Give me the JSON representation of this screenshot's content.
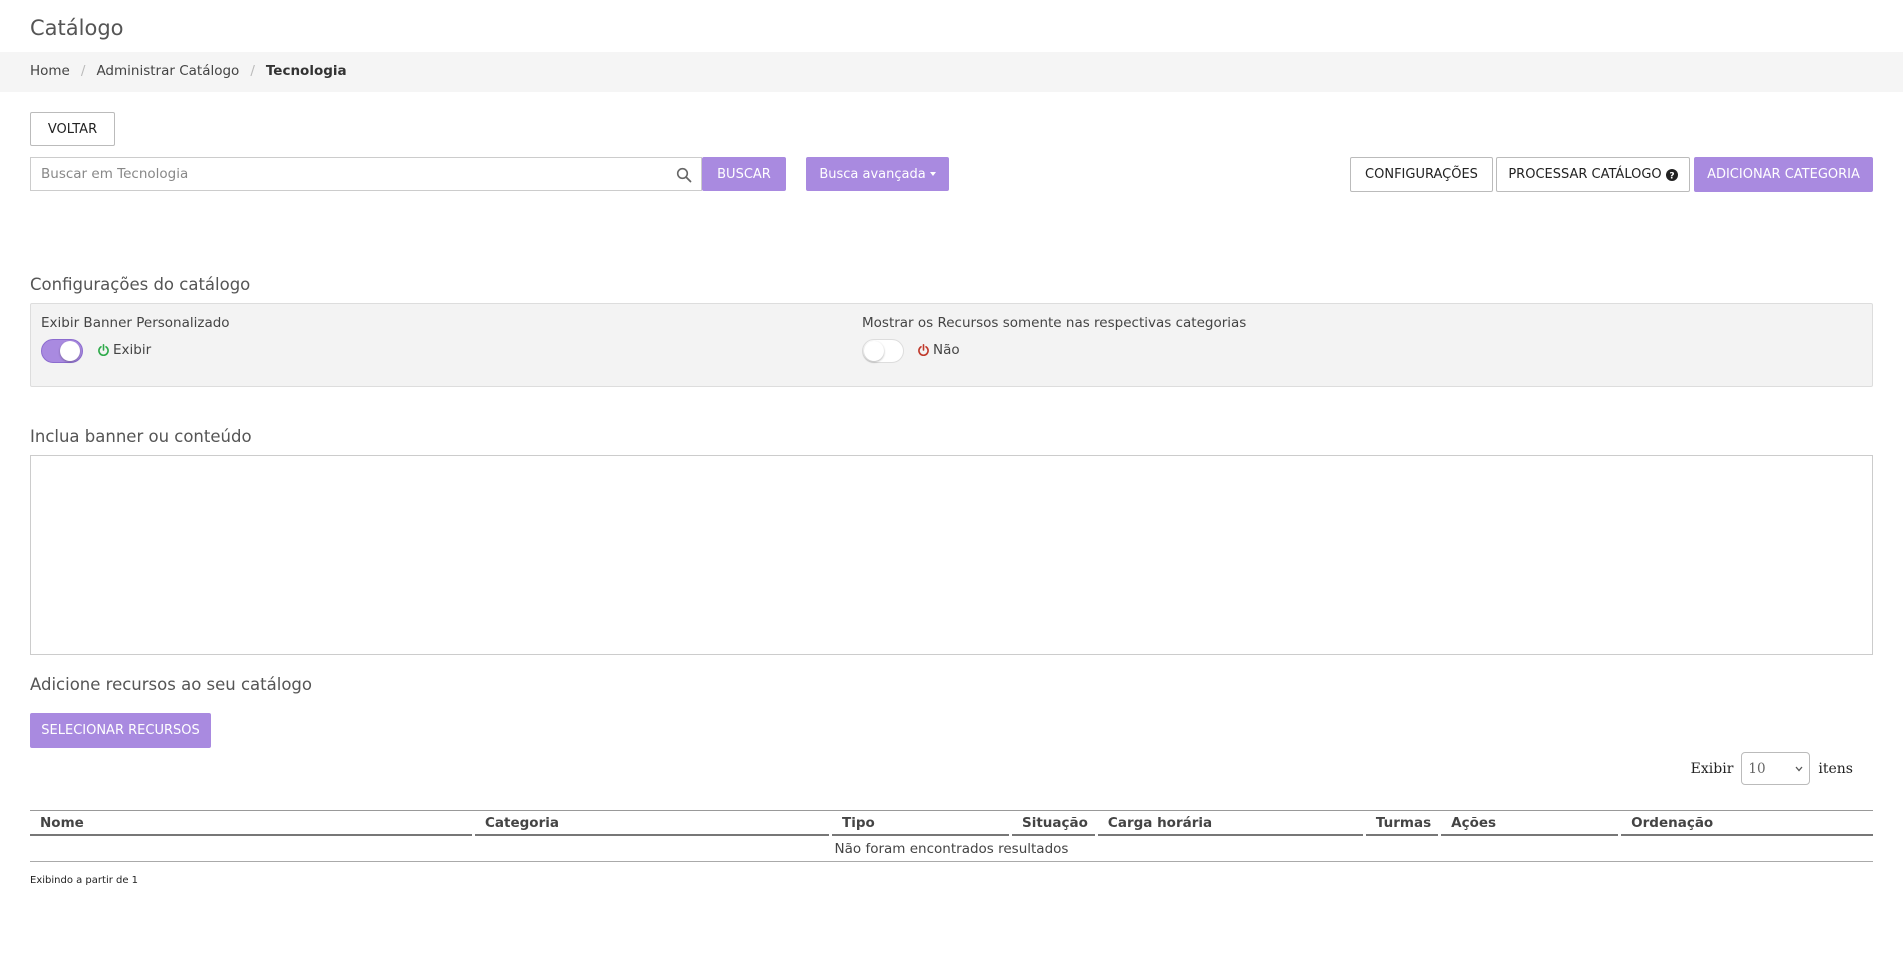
{
  "page": {
    "title": "Catálogo"
  },
  "breadcrumb": {
    "home": "Home",
    "admin": "Administrar Catálogo",
    "current": "Tecnologia"
  },
  "toolbar": {
    "back_label": "VOLTAR",
    "search_placeholder": "Buscar em Tecnologia",
    "search_label": "BUSCAR",
    "advanced_label": "Busca avançada",
    "settings_label": "CONFIGURAÇÕES",
    "process_label": "PROCESSAR CATÁLOGO",
    "add_category_label": "ADICIONAR CATEGORIA"
  },
  "config": {
    "title": "Configurações do catálogo",
    "banner": {
      "label": "Exibir Banner Personalizado",
      "status": "Exibir",
      "enabled": true,
      "status_color": "#2eaa4a"
    },
    "resources": {
      "label": "Mostrar os Recursos somente nas respectivas categorias",
      "status": "Não",
      "enabled": false,
      "status_color": "#c0392b"
    }
  },
  "banner_section": {
    "title": "Inclua banner ou conteúdo"
  },
  "resources_section": {
    "title": "Adicione recursos ao seu catálogo",
    "select_label": "SELECIONAR RECURSOS"
  },
  "pagination": {
    "show_label": "Exibir",
    "page_size": "10",
    "items_label": "itens"
  },
  "table": {
    "columns": [
      "Nome",
      "Categoria",
      "Tipo",
      "Situação",
      "Carga horária",
      "Turmas",
      "Ações",
      "Ordenação"
    ],
    "empty_message": "Não foram encontrados resultados"
  },
  "footer": {
    "summary": "Exibindo a partir de 1"
  },
  "colors": {
    "accent": "#a98ae0"
  }
}
